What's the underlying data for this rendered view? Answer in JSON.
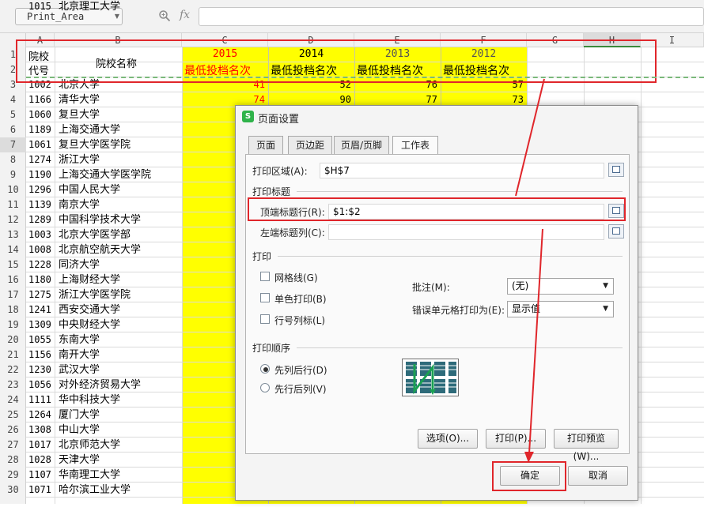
{
  "formula_bar": {
    "name_box": "Print_Area",
    "zoom_icon": "zoom-icon",
    "fx_label": "fx",
    "formula": ""
  },
  "columns": [
    "A",
    "B",
    "C",
    "D",
    "E",
    "F",
    "G",
    "H",
    "I"
  ],
  "rows": [
    "1",
    "2",
    "3",
    "4",
    "5",
    "6",
    "7",
    "8",
    "9",
    "10",
    "11",
    "12",
    "13",
    "14",
    "15",
    "16",
    "17",
    "18",
    "19",
    "20",
    "21",
    "22",
    "23",
    "24",
    "25",
    "26",
    "27",
    "28",
    "29",
    "30"
  ],
  "header_row": {
    "a1": "院校",
    "a2": "代号",
    "b": "院校名称",
    "years": [
      "2015",
      "2014",
      "2013",
      "2012"
    ],
    "sub": "最低投档名次"
  },
  "table": [
    {
      "code": "1002",
      "name": "北京大学",
      "v2015": "41",
      "v2014": "52",
      "v2013": "76",
      "v2012": "57"
    },
    {
      "code": "1166",
      "name": "清华大学",
      "v2015": "74",
      "v2014": "90",
      "v2013": "77",
      "v2012": "73"
    },
    {
      "code": "1060",
      "name": "复旦大学"
    },
    {
      "code": "1189",
      "name": "上海交通大学"
    },
    {
      "code": "1061",
      "name": "复旦大学医学院"
    },
    {
      "code": "1274",
      "name": "浙江大学"
    },
    {
      "code": "1190",
      "name": "上海交通大学医学院"
    },
    {
      "code": "1296",
      "name": "中国人民大学"
    },
    {
      "code": "1139",
      "name": "南京大学"
    },
    {
      "code": "1289",
      "name": "中国科学技术大学"
    },
    {
      "code": "1003",
      "name": "北京大学医学部"
    },
    {
      "code": "1008",
      "name": "北京航空航天大学"
    },
    {
      "code": "1228",
      "name": "同济大学"
    },
    {
      "code": "1180",
      "name": "上海财经大学"
    },
    {
      "code": "1275",
      "name": "浙江大学医学院"
    },
    {
      "code": "1241",
      "name": "西安交通大学"
    },
    {
      "code": "1309",
      "name": "中央财经大学"
    },
    {
      "code": "1055",
      "name": "东南大学"
    },
    {
      "code": "1156",
      "name": "南开大学"
    },
    {
      "code": "1230",
      "name": "武汉大学"
    },
    {
      "code": "1056",
      "name": "对外经济贸易大学"
    },
    {
      "code": "1111",
      "name": "华中科技大学"
    },
    {
      "code": "1264",
      "name": "厦门大学"
    },
    {
      "code": "1308",
      "name": "中山大学"
    },
    {
      "code": "1017",
      "name": "北京师范大学"
    },
    {
      "code": "1028",
      "name": "天津大学"
    },
    {
      "code": "1107",
      "name": "华南理工大学"
    },
    {
      "code": "1071",
      "name": "哈尔滨工业大学"
    },
    {
      "code": "1015",
      "name": "北京理工大学"
    }
  ],
  "dialog": {
    "logo": "S",
    "title": "页面设置",
    "tabs": [
      "页面",
      "页边距",
      "页眉/页脚",
      "工作表"
    ],
    "active_tab": "工作表",
    "print_area_label": "打印区域(A):",
    "print_area_value": "$H$7",
    "print_titles_label": "打印标题",
    "top_rows_label": "顶端标题行(R):",
    "top_rows_value": "$1:$2",
    "left_cols_label": "左端标题列(C):",
    "left_cols_value": "",
    "print_section_label": "打印",
    "gridlines_label": "网格线(G)",
    "mono_label": "单色打印(B)",
    "rowcol_label": "行号列标(L)",
    "comments_label": "批注(M):",
    "comments_value": "(无)",
    "errors_label": "错误单元格打印为(E):",
    "errors_value": "显示值",
    "order_label": "打印顺序",
    "order_down": "先列后行(D)",
    "order_over": "先行后列(V)",
    "order_selected": "先列后行(D)",
    "options_btn": "选项(O)...",
    "print_btn": "打印(P)...",
    "preview_btn": "打印预览(W)...",
    "ok_btn": "确定",
    "cancel_btn": "取消"
  },
  "colors": {
    "highlight": "#ffff00",
    "year_red": "#ff0000",
    "annotation_red": "#e0262b",
    "dialog_logo": "#2fb34a"
  }
}
